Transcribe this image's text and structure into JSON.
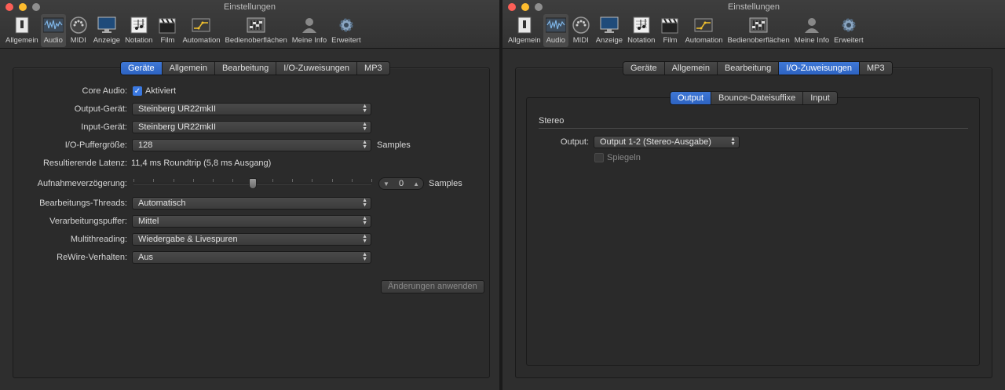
{
  "window_title": "Einstellungen",
  "toolbar": [
    {
      "label": "Allgemein",
      "icon": "general-switch-icon"
    },
    {
      "label": "Audio",
      "icon": "audio-waveform-icon"
    },
    {
      "label": "MIDI",
      "icon": "midi-connector-icon"
    },
    {
      "label": "Anzeige",
      "icon": "display-monitor-icon"
    },
    {
      "label": "Notation",
      "icon": "notation-icon"
    },
    {
      "label": "Film",
      "icon": "clapperboard-icon"
    },
    {
      "label": "Automation",
      "icon": "automation-icon"
    },
    {
      "label": "Bedienoberflächen",
      "icon": "control-surface-icon"
    },
    {
      "label": "Meine Info",
      "icon": "user-silhouette-icon"
    },
    {
      "label": "Erweitert",
      "icon": "gear-icon"
    }
  ],
  "tabs": [
    "Geräte",
    "Allgemein",
    "Bearbeitung",
    "I/O-Zuweisungen",
    "MP3"
  ],
  "left": {
    "active_tab": "Geräte",
    "core_audio_label": "Core Audio:",
    "core_audio_checkbox": "Aktiviert",
    "output_device_label": "Output-Gerät:",
    "output_device_value": "Steinberg UR22mkII",
    "input_device_label": "Input-Gerät:",
    "input_device_value": "Steinberg UR22mkII",
    "buffer_label": "I/O-Puffergröße:",
    "buffer_value": "128",
    "buffer_unit": "Samples",
    "latency_label": "Resultierende Latenz:",
    "latency_value": "11,4 ms Roundtrip (5,8 ms Ausgang)",
    "recording_delay_label": "Aufnahmeverzögerung:",
    "recording_delay_value": "0",
    "recording_delay_unit": "Samples",
    "recording_delay_slider": 0.5,
    "threads_label": "Bearbeitungs-Threads:",
    "threads_value": "Automatisch",
    "processing_buffer_label": "Verarbeitungspuffer:",
    "processing_buffer_value": "Mittel",
    "multithreading_label": "Multithreading:",
    "multithreading_value": "Wiedergabe & Livespuren",
    "rewire_label": "ReWire-Verhalten:",
    "rewire_value": "Aus",
    "apply_button": "Änderungen anwenden"
  },
  "right": {
    "active_tab": "I/O-Zuweisungen",
    "subtabs": [
      "Output",
      "Bounce-Dateisuffixe",
      "Input"
    ],
    "active_subtab": "Output",
    "section": "Stereo",
    "output_label": "Output:",
    "output_value": "Output 1-2 (Stereo-Ausgabe)",
    "mirror_checkbox": "Spiegeln"
  },
  "colors": {
    "accent": "#3a78e0",
    "window_bg": "#2e2e2e"
  }
}
